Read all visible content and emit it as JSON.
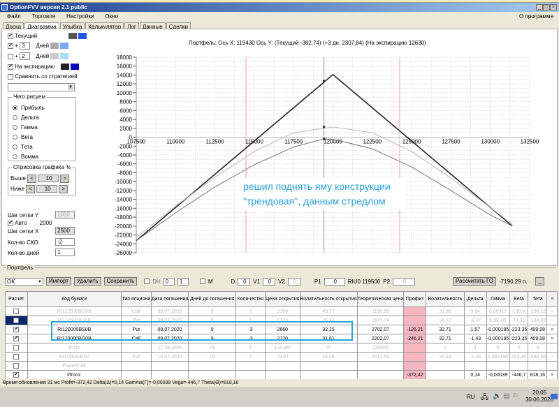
{
  "window": {
    "title": "OptionFVV версия 2.1 public",
    "about": "О программе"
  },
  "menu": [
    "Файл",
    "Торговля",
    "Настройки",
    "Окно"
  ],
  "tabs": [
    "Доска",
    "Диаграмма",
    "Улыбка",
    "Калькулятор",
    "Лог",
    "Данные",
    "Сделки"
  ],
  "left_panel": {
    "current_label": "Текущий",
    "plus1_days": "3",
    "plus2_days": "2",
    "days_label": "Дней",
    "plus": "+",
    "expiry_label": "На экспирацию",
    "compare_label": "Сравнить со стратегией",
    "draw_group": "Чего рисуем",
    "draw_options": [
      "Прибыль",
      "Дельта",
      "Гамма",
      "Вега",
      "Тета",
      "Вомма"
    ],
    "draw_selected": "Прибыль",
    "range_group": "Отрисовка графика %",
    "above_label": "Выше",
    "above_value": "10",
    "below_label": "Ниже",
    "below_value": "10",
    "grid_y_label": "Шаг сетки Y",
    "grid_y_value": "1000",
    "auto_label": "Авто",
    "auto_value": "2000",
    "grid_x_label": "Шаг сетки X",
    "grid_x_value": "2500",
    "sko_label": "Кол-во СКО",
    "sko_value": "-2",
    "days_count_label": "Кол-во дней",
    "days_count_value": "1",
    "colors": {
      "current": [
        "#555555",
        "#2255ee"
      ],
      "plus1": [
        "#aaaaaa",
        "#77aaee"
      ],
      "plus2": [
        "#cccccc",
        "#aaddff"
      ],
      "expiry": [
        "#222222",
        "#0000bb"
      ]
    }
  },
  "chart_data": {
    "type": "line",
    "title": "Портфель: Ось X: 119430 Ось Y:  (Текущий -382,74)  (+3 дн. 2307,84)  (На экспирацию 12630)",
    "xlim": [
      107500,
      132500
    ],
    "ylim": [
      -26000,
      18000
    ],
    "xticks": [
      107500,
      110000,
      112500,
      115000,
      117500,
      120000,
      122500,
      125000,
      127500,
      130000,
      132500
    ],
    "yticks": [
      18000,
      16000,
      14000,
      12000,
      10000,
      8000,
      6000,
      4000,
      2000,
      0,
      -2000,
      -4000,
      -6000,
      -8000,
      -10000,
      -12000,
      -14000,
      -16000,
      -18000,
      -20000,
      -22000,
      -24000,
      -26000
    ],
    "grid": true,
    "current_price": 119430,
    "sigma_lines": [
      114470,
      124240
    ],
    "series": [
      {
        "name": "На экспирацию",
        "color": "#222222",
        "points": [
          [
            107500,
            -23300
          ],
          [
            120000,
            14100
          ],
          [
            131400,
            -20000
          ]
        ],
        "marker": [
          119430,
          12630
        ]
      },
      {
        "name": "+3 дн.",
        "color": "#bbbbbb",
        "points": [
          [
            107500,
            -22600
          ],
          [
            110000,
            -15500
          ],
          [
            112500,
            -9000
          ],
          [
            115000,
            -3200
          ],
          [
            117500,
            1000
          ],
          [
            120000,
            2308
          ],
          [
            122500,
            1000
          ],
          [
            125000,
            -3200
          ],
          [
            127500,
            -9200
          ],
          [
            130000,
            -15800
          ],
          [
            131400,
            -19600
          ]
        ],
        "marker": [
          119430,
          2308
        ]
      },
      {
        "name": "Текущий",
        "color": "#777777",
        "points": [
          [
            107500,
            -23300
          ],
          [
            110000,
            -17000
          ],
          [
            112500,
            -11200
          ],
          [
            115000,
            -6200
          ],
          [
            117500,
            -2200
          ],
          [
            119430,
            -383
          ],
          [
            120000,
            -450
          ],
          [
            122500,
            -2600
          ],
          [
            125000,
            -6700
          ],
          [
            127500,
            -12000
          ],
          [
            130000,
            -17500
          ],
          [
            131400,
            -20000
          ]
        ],
        "marker": [
          119430,
          -383
        ]
      }
    ]
  },
  "annotation": [
    "решил поднять яму конструкции",
    "\"трендовая\", данным стредлом"
  ],
  "portfolio": {
    "label": "Портфель",
    "select": "OK",
    "import": "Импорт",
    "delete": "Удалить",
    "save": "Сохранить",
    "dh_label": "DH",
    "dh1": "0",
    "dh2": "1",
    "m_label": "M",
    "d_label": "D",
    "d": "0",
    "v1_label": "V1",
    "v1": "0",
    "v2_label": "V2",
    "v2": "0",
    "p1_label": "P1",
    "p1": "0",
    "riu": "RIU0 119500",
    "p2_label": "P2",
    "p2": "0",
    "calc_go": "Рассчитать ГО",
    "go_value": "-7190,29 п.",
    "min": "_",
    "columns": [
      "Расчет",
      "Код бумаги",
      "Тип опциона",
      "Дата погашения",
      "Дней до погашения",
      "Количество",
      "Цена открытия",
      "Волатильность открытия",
      "Теоретическая цена",
      "Профит",
      "Волатильность",
      "Дельта",
      "Гамма",
      "Вега",
      "Тета",
      "×"
    ],
    "rows": [
      {
        "checked": false,
        "dim": true,
        "cells": [
          "RI122500BG0B",
          "Call",
          "09.07.2020",
          "9",
          "2",
          "2160",
          "45,77",
          "1198,29",
          "",
          "31,88",
          "0,64",
          "0,00012",
          "133,4",
          "-238,12"
        ]
      },
      {
        "checked": false,
        "dim": true,
        "selected": true,
        "cells": [
          "RI117500BS0B",
          "Put",
          "09.07.2020",
          "9",
          "1",
          "1720",
          "35,14",
          "1647,74",
          "",
          "34,12",
          "-0,37",
          "5,9E-05",
          "70,31",
          "-134,32"
        ]
      },
      {
        "checked": true,
        "dim": false,
        "cells": [
          "RI120000BS0B",
          "Put",
          "09.07.2020",
          "9",
          "-3",
          "2660",
          "32,15",
          "2702,07",
          "-126,21",
          "32,71",
          "1,57",
          "-0,000195",
          "-223,35",
          "409,08"
        ]
      },
      {
        "checked": true,
        "dim": false,
        "cells": [
          "RI120000BG0B",
          "Call",
          "09.07.2020",
          "9",
          "-3",
          "2120",
          "31,61",
          "2202,07",
          "-246,21",
          "32,71",
          "-1,43",
          "-0,000195",
          "-223,35",
          "409,08"
        ]
      },
      {
        "checked": false,
        "dim": true,
        "cells": [
          "RIU0",
          "",
          "17.09.2020",
          "79",
          "1",
          "120380",
          "0",
          "119500",
          "",
          "0",
          "1",
          "0",
          "0",
          "0"
        ]
      },
      {
        "checked": false,
        "dim": true,
        "cells": [
          "RI115000BS0",
          "Put",
          "16.07.2020",
          "16",
          "5",
          "2420",
          "44,06",
          "1613,55",
          "",
          "34,83",
          "-1,43",
          "0,000196",
          "424,45",
          "-464,58"
        ]
      },
      {
        "checked": false,
        "dim": true,
        "cells": [
          "FixedProfit",
          "",
          "",
          "",
          "",
          "",
          "",
          "",
          "",
          "",
          "",
          "",
          "",
          ""
        ]
      },
      {
        "checked": true,
        "dim": false,
        "cells": [
          "Итого:",
          "",
          "",
          "",
          "",
          "",
          "",
          "",
          "-372,42",
          "",
          "0,14",
          "-0,00039",
          "-446,7",
          "818,16"
        ]
      }
    ]
  },
  "status": "Время обновления 31 мс  Profit=-372,42 Delta(Δ)=0,14 Gamma(Γ)=-0,00039 Vega=-446,7 Theta(Θ)=818,16",
  "taskbar": {
    "lang": "RU",
    "time": "20:05",
    "date": "30.06.2020"
  }
}
